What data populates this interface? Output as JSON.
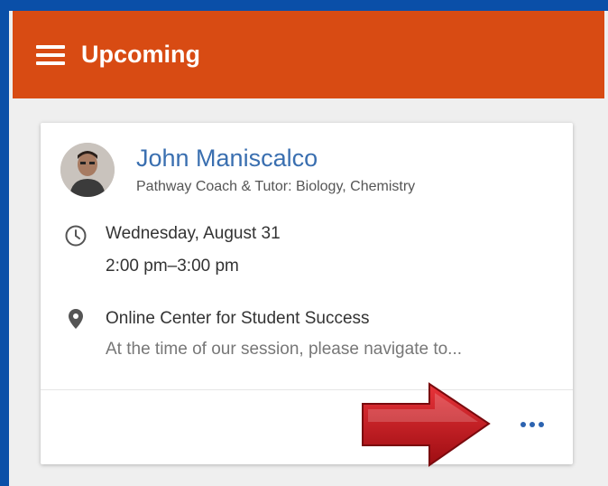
{
  "header": {
    "title": "Upcoming"
  },
  "appointment": {
    "name": "John Maniscalco",
    "role": "Pathway Coach & Tutor: Biology, Chemistry",
    "date": "Wednesday, August 31",
    "time": "2:00 pm–3:00 pm",
    "location": "Online Center for Student Success",
    "note": "At the time of our session, please navigate to..."
  },
  "icons": {
    "menu": "menu-icon",
    "clock": "clock-icon",
    "pin": "location-pin-icon",
    "more": "more-options-icon",
    "arrow": "red-arrow-annotation"
  },
  "colors": {
    "frame_blue": "#0a4fa8",
    "header_orange": "#d84b13",
    "link_blue": "#3a6fb0",
    "arrow_red": "#c8141a"
  }
}
